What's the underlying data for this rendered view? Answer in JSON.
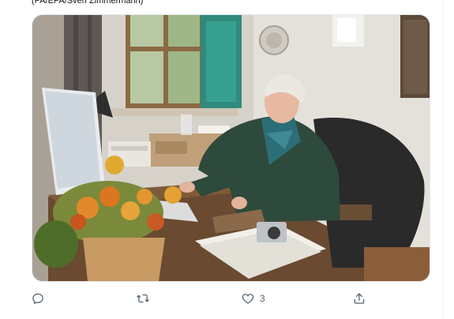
{
  "tweet": {
    "caption": "(PA/EPA/Sven Zimmermann)",
    "image_alt": "Elderly man with white hair and a green cardigan sitting at a desk with an iMac, flowers and a camera"
  },
  "actions": {
    "reply": {
      "icon": "reply-icon"
    },
    "retweet": {
      "icon": "retweet-icon"
    },
    "like": {
      "icon": "heart-icon",
      "count": "3"
    },
    "share": {
      "icon": "share-icon"
    }
  },
  "colors": {
    "icon": "#536471",
    "border": "#e5e9ec"
  }
}
